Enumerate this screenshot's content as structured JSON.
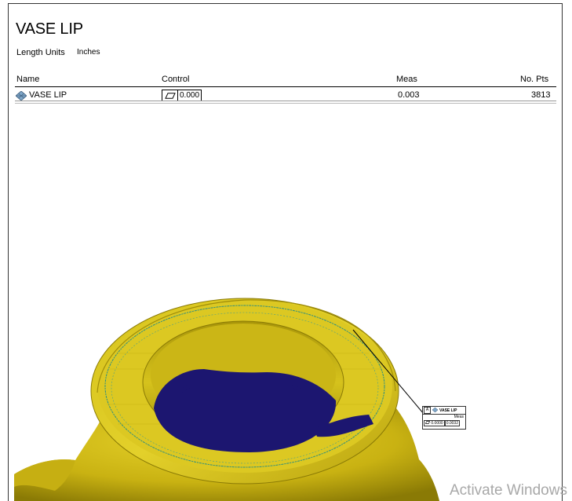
{
  "report": {
    "title": "VASE LIP",
    "length_units_label": "Length Units",
    "length_units_value": "Inches"
  },
  "table": {
    "headers": [
      "Name",
      "Control",
      "Meas",
      "No. Pts"
    ],
    "rows": [
      {
        "name": "VASE LIP",
        "control_symbol": "flatness-icon",
        "control": "0.000",
        "meas": "0.003",
        "no_pts": "3813"
      }
    ]
  },
  "callout": {
    "label": "A",
    "name": "VASE LIP",
    "meas_label": "Meas",
    "control": "0.0000",
    "meas": "0.0032"
  },
  "watermark": "Activate Windows",
  "colors": {
    "model_yellow": "#d8c21a",
    "model_shadow": "#8a7a05",
    "cavity": "#1c1670",
    "deviation_line": "#2f8f80"
  }
}
